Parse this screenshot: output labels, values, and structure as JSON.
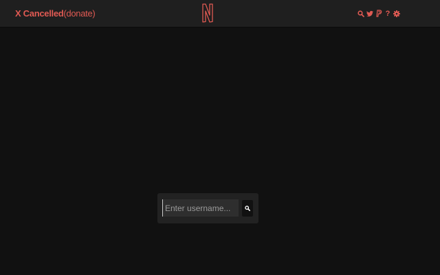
{
  "header": {
    "brand_prefix": "X Cancelled",
    "brand_link": "(donate)",
    "logo_letter": "N",
    "help_label": "?"
  },
  "search": {
    "placeholder": "Enter username..."
  },
  "icons": [
    "search-icon",
    "twitter-icon",
    "paypal-icon",
    "help-icon",
    "gear-icon"
  ],
  "colors": {
    "accent": "#e05a53",
    "background": "#111111",
    "header_bg": "#1f1f1f",
    "panel_bg": "#222222"
  }
}
